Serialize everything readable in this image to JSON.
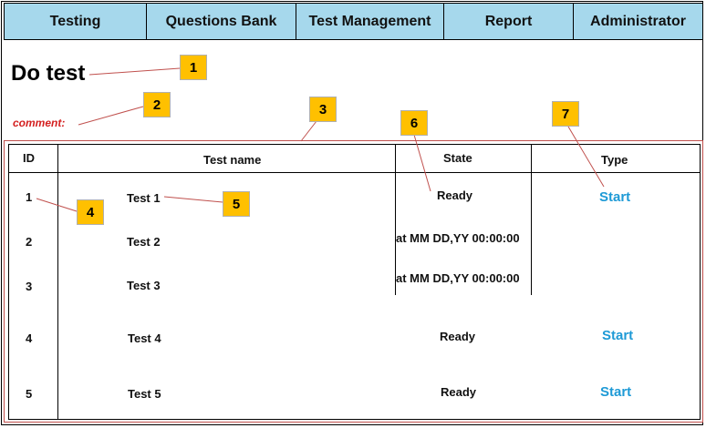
{
  "nav": {
    "items": [
      {
        "label": "Testing"
      },
      {
        "label": "Questions Bank"
      },
      {
        "label": "Test Management"
      },
      {
        "label": "Report"
      },
      {
        "label": "Administrator"
      }
    ]
  },
  "page": {
    "title": "Do test",
    "comment": "comment:"
  },
  "table": {
    "headers": {
      "id": "ID",
      "name": "Test name",
      "state": "State",
      "type": "Type"
    },
    "rows": [
      {
        "id": "1",
        "name": "Test 1",
        "state": "Ready",
        "type": "Start"
      },
      {
        "id": "2",
        "name": "Test 2",
        "state": "at MM DD,YY 00:00:00",
        "type": ""
      },
      {
        "id": "3",
        "name": "Test 3",
        "state": "at MM DD,YY 00:00:00",
        "type": ""
      },
      {
        "id": "4",
        "name": "Test 4",
        "state": "Ready",
        "type": "Start"
      },
      {
        "id": "5",
        "name": "Test 5",
        "state": "Ready",
        "type": "Start"
      }
    ]
  },
  "annotations": [
    "1",
    "2",
    "3",
    "4",
    "5",
    "6",
    "7"
  ],
  "colors": {
    "nav_bg": "#a6d8ec",
    "comment": "#d42020",
    "start_link": "#1e9ad6",
    "badge": "#ffc000",
    "callout_line": "#c0504d"
  }
}
